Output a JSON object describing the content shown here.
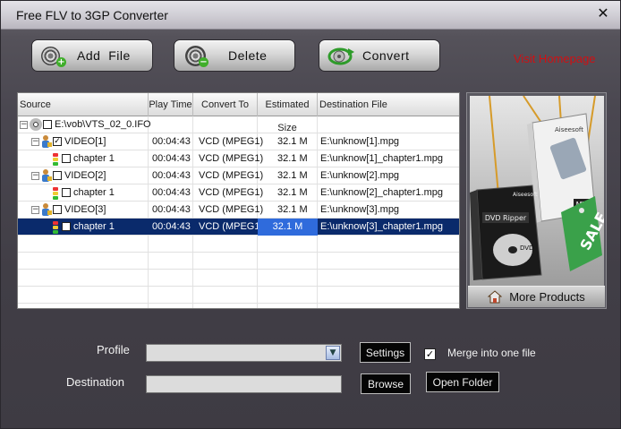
{
  "window": {
    "title": "Free FLV to 3GP Converter",
    "close_symbol": "✕"
  },
  "toolbar": {
    "add_file_label": "Add  File",
    "delete_label": "Delete",
    "convert_label": "Convert"
  },
  "visit_homepage": "Visit Homepage",
  "grid": {
    "columns": [
      "Source",
      "Play Time",
      "Convert To",
      "Estimated Size",
      "Destination File"
    ],
    "rows": [
      {
        "source": "E:\\vob\\VTS_02_0.IFO",
        "play": "",
        "convert": "",
        "size": "",
        "dest": ""
      },
      {
        "source": "VIDEO[1]",
        "play": "00:04:43",
        "convert": "VCD (MPEG1)",
        "size": "32.1 M",
        "dest": "E:\\unknow[1].mpg"
      },
      {
        "source": "chapter 1",
        "play": "00:04:43",
        "convert": "VCD (MPEG1)",
        "size": "32.1 M",
        "dest": "E:\\unknow[1]_chapter1.mpg"
      },
      {
        "source": "VIDEO[2]",
        "play": "00:04:43",
        "convert": "VCD (MPEG1)",
        "size": "32.1 M",
        "dest": "E:\\unknow[2].mpg"
      },
      {
        "source": "chapter 1",
        "play": "00:04:43",
        "convert": "VCD (MPEG1)",
        "size": "32.1 M",
        "dest": "E:\\unknow[2]_chapter1.mpg"
      },
      {
        "source": "VIDEO[3]",
        "play": "00:04:43",
        "convert": "VCD (MPEG1)",
        "size": "32.1 M",
        "dest": "E:\\unknow[3].mpg"
      },
      {
        "source": "chapter 1",
        "play": "00:04:43",
        "convert": "VCD (MPEG1)",
        "size": "32.1 M",
        "dest": "E:\\unknow[3]_chapter1.mpg"
      }
    ]
  },
  "side": {
    "brand": "Aiseesoft",
    "box_dvd_label": "DVD Ripper",
    "box_mts_label": "MTS",
    "dvd_disc_text": "DVD",
    "sale_text": "SALE",
    "more_products_label": "More Products"
  },
  "options": {
    "profile_label": "Profile",
    "profile_value": "",
    "destination_label": "Destination",
    "destination_value": "",
    "settings_label": "Settings",
    "browse_label": "Browse",
    "open_folder_label": "Open Folder",
    "merge_label": "Merge into one file",
    "merge_checked": true
  },
  "colors": {
    "accent_red": "#d10f12",
    "selection": "#0a2a6b",
    "selection_cell": "#2f6bdc"
  }
}
